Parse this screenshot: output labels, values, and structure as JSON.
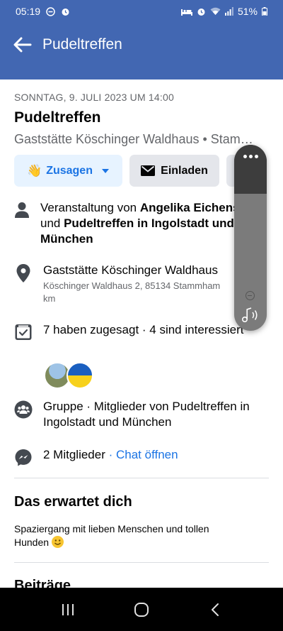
{
  "status_bar": {
    "time": "05:19",
    "battery": "51%",
    "left_icons": [
      "minus-circle-icon",
      "alarm-icon"
    ],
    "right_icons": [
      "bed-icon",
      "alarm-icon",
      "wifi-icon",
      "signal-icon",
      "battery-icon"
    ]
  },
  "header": {
    "title": "Pudeltreffen",
    "back_icon": "arrow-left-icon",
    "color": "#4267b2"
  },
  "event": {
    "date": "SONNTAG, 9. JULI 2023 UM 14:00",
    "title": "Pudeltreffen",
    "subtitle": "Gaststätte Köschinger Waldhaus • Stam…"
  },
  "buttons": {
    "going": {
      "emoji": "👋",
      "label": "Zusagen"
    },
    "invite": {
      "label": "Einladen"
    }
  },
  "details": {
    "host_prefix": "Veranstaltung von ",
    "host_name": "Angelika Eichenseher",
    "host_and": " und ",
    "host_group": "Pudeltreffen in Ingolstadt und München",
    "location_name": "Gaststätte Köschinger Waldhaus",
    "location_address": "Köschinger Waldhaus 2, 85134 Stammham",
    "location_distance": "km",
    "attendance": "7 haben zugesagt · 4 sind interessiert",
    "group_text": "Gruppe · Mitglieder von Pudeltreffen in Ingolstadt und München",
    "members_text": "2 Mitglieder",
    "members_sep": " · ",
    "chat_link": "Chat öffnen"
  },
  "about": {
    "title": "Das erwartet dich",
    "description": "Spaziergang mit lieben Menschen und tollen Hunden"
  },
  "posts": {
    "title": "Beiträge"
  },
  "navbar": {
    "recent_icon": "recent-apps-icon",
    "home_icon": "home-icon",
    "back_icon": "back-icon"
  },
  "colors": {
    "accent": "#1b74e4",
    "going_bg": "#e7f3ff",
    "secondary_text": "#65676b"
  }
}
